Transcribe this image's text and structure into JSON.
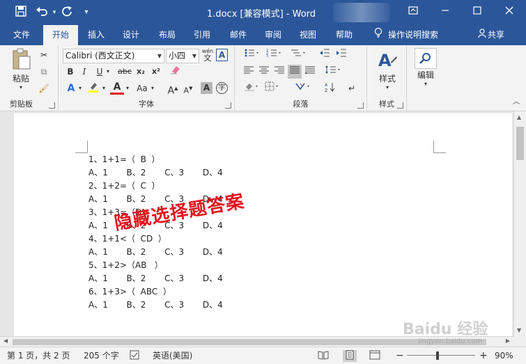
{
  "titlebar": {
    "doc_title": "1.docx [兼容模式] - Word",
    "save_icon": "save-icon",
    "undo_icon": "undo-icon",
    "redo_icon": "repeat-icon",
    "customize_icon": "customize-qat-icon"
  },
  "tabs": [
    {
      "label": "文件"
    },
    {
      "label": "开始"
    },
    {
      "label": "插入"
    },
    {
      "label": "设计"
    },
    {
      "label": "布局"
    },
    {
      "label": "引用"
    },
    {
      "label": "邮件"
    },
    {
      "label": "审阅"
    },
    {
      "label": "视图"
    },
    {
      "label": "帮助"
    }
  ],
  "tell_me": "操作说明搜索",
  "share": "共享",
  "ribbon": {
    "clipboard": {
      "label": "剪贴板",
      "paste": "粘贴"
    },
    "font": {
      "label": "字体",
      "font_name": "Calibri (西文正文)",
      "font_size": "小四",
      "wen_glyph": "wén",
      "bold": "B",
      "italic": "I",
      "underline": "U",
      "strike": "abc",
      "subscript": "x₂",
      "superscript": "x²",
      "case": "Aa",
      "grow": "A",
      "shrink": "A",
      "shade": "A",
      "enclose": "字"
    },
    "paragraph": {
      "label": "段落"
    },
    "styles": {
      "label": "样式",
      "button": "样式"
    },
    "editing": {
      "label": "",
      "button": "编辑"
    }
  },
  "document": {
    "lines": [
      "1、1+1=（  B  ）",
      "A、1       B、2       C、3       D、4",
      "2、1+2=（  C  ）",
      "A、1       B、2       C、3       D、4",
      "3、1+3=（D",
      "A、1       B、2       C、3       D、4",
      "4、1+1<（  CD  ）",
      "A、1       B、2       C、3       D、4",
      "5、1+2>（AB   ）",
      "A、1       B、2       C、3       D、4",
      "6、1+3>（  ABC  ）",
      "A、1       B、2       C、3       D、4"
    ],
    "overlay_text": "隐藏选择题答案"
  },
  "status": {
    "page": "第 1 页，共 2 页",
    "words": "205 个字",
    "language": "英语(美国)",
    "zoom": "90%",
    "zoom_minus": "−",
    "zoom_plus": "+"
  },
  "watermark": "Baidu 经验",
  "watermark_sub": "jingyan.baidu.com",
  "colors": {
    "brand": "#2b579a",
    "stamp": "#e0141e"
  }
}
